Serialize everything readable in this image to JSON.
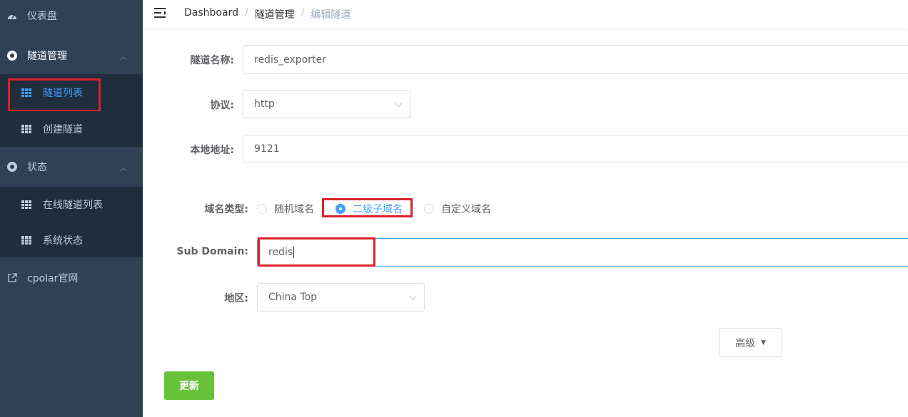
{
  "sidebar": {
    "items": [
      {
        "label": "仪表盘",
        "icon": "dashboard-icon"
      },
      {
        "label": "隧道管理",
        "icon": "circle-icon"
      },
      {
        "label": "隧道列表",
        "icon": "table-icon"
      },
      {
        "label": "创建隧道",
        "icon": "table-icon"
      },
      {
        "label": "状态",
        "icon": "circle-icon"
      },
      {
        "label": "在线隧道列表",
        "icon": "table-icon"
      },
      {
        "label": "系统状态",
        "icon": "table-icon"
      },
      {
        "label": "cpolar官网",
        "icon": "external-link-icon"
      }
    ]
  },
  "breadcrumb": [
    "Dashboard",
    "隧道管理",
    "编辑隧道"
  ],
  "breadcrumb_sep": "/",
  "form": {
    "name_label": "隧道名称:",
    "name_value": "redis_exporter",
    "protocol_label": "协议:",
    "protocol_value": "http",
    "local_label": "本地地址:",
    "local_value": "9121",
    "domain_type_label": "域名类型:",
    "domain_options": [
      "随机域名",
      "二级子域名",
      "自定义域名"
    ],
    "domain_selected": "二级子域名",
    "subdomain_label": "Sub Domain:",
    "subdomain_value": "redis",
    "region_label": "地区:",
    "region_value": "China Top",
    "advanced_label": "高级",
    "submit_label": "更新"
  },
  "colors": {
    "sidebar_bg": "#304156",
    "active": "#409eff",
    "highlight": "#d9232a",
    "submit": "#67c23a"
  }
}
